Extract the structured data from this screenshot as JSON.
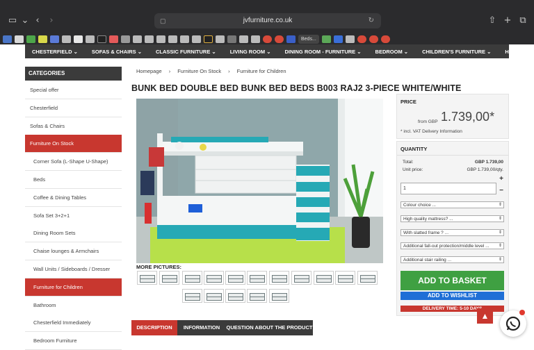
{
  "browser": {
    "url": "jvfurniture.co.uk",
    "active_tab_label": "Beds...",
    "icons": [
      "sidebar-icon",
      "chevron-down-icon",
      "back-icon",
      "forward-icon",
      "tabs-icon",
      "reload-icon",
      "share-icon",
      "new-tab-icon",
      "tab-overview-icon"
    ]
  },
  "site_nav": {
    "items": [
      "CHESTERFIELD ⌄",
      "SOFAS & CHAIRS ⌄",
      "CLASSIC FURNITURE ⌄",
      "LIVING ROOM ⌄",
      "DINING ROOM - FURNITURE ⌄",
      "BEDROOM ⌄",
      "CHILDREN'S FURNITURE ⌄",
      "HOME DECOR ⌄"
    ]
  },
  "sidebar": {
    "header": "CATEGORIES",
    "items": [
      {
        "label": "Special offer",
        "sub": false,
        "active": false
      },
      {
        "label": "Chesterfield",
        "sub": false,
        "active": false
      },
      {
        "label": "Sofas & Chairs",
        "sub": false,
        "active": false
      },
      {
        "label": "Furniture On Stock",
        "sub": false,
        "active": true
      },
      {
        "label": "Corner Sofa (L-Shape U-Shape)",
        "sub": true,
        "active": false
      },
      {
        "label": "Beds",
        "sub": true,
        "active": false
      },
      {
        "label": "Coffee & Dining Tables",
        "sub": true,
        "active": false
      },
      {
        "label": "Sofa Set 3+2+1",
        "sub": true,
        "active": false
      },
      {
        "label": "Dining Room Sets",
        "sub": true,
        "active": false
      },
      {
        "label": "Chaise lounges & Armchairs",
        "sub": true,
        "active": false
      },
      {
        "label": "Wall Units / Sideboards / Dresser",
        "sub": true,
        "active": false
      },
      {
        "label": "Furniture for Children",
        "sub": true,
        "active": true
      },
      {
        "label": "Bathroom",
        "sub": true,
        "active": false
      },
      {
        "label": "Chesterfield Immediately",
        "sub": true,
        "active": false
      },
      {
        "label": "Bedroom Furniture",
        "sub": true,
        "active": false
      }
    ]
  },
  "breadcrumb": [
    "Homepage",
    "Furniture On Stock",
    "Furniture for Children"
  ],
  "breadcrumb_sep": "›",
  "product": {
    "title": "BUNK BED DOUBLE BED BUNK BED BEDS B003 RAJ2 3-PIECE WHITE/WHITE",
    "more_pictures_label": "MORE PICTURES:"
  },
  "price": {
    "header": "PRICE",
    "from_label": "from GBP",
    "amount": "1.739,00*",
    "note": "* incl. VAT Delivery Information"
  },
  "quantity": {
    "header": "QUANTITY",
    "total_label": "Total:",
    "total_value": "GBP 1.739,00",
    "unit_label": "Unit price:",
    "unit_value": "GBP 1.739,00/qty.",
    "value": "1",
    "plus": "+",
    "minus": "−"
  },
  "options": [
    "Colour choice ...",
    "High quality mattress? ...",
    "With slatted frame ? ...",
    "Additional fall-out protection/middle level ...",
    "Additional stair railing ..."
  ],
  "actions": {
    "add_basket": "ADD TO BASKET",
    "add_wishlist": "ADD TO WISHLIST",
    "delivery": "DELIVERY TIME: 5-10 DAYS"
  },
  "tabs": [
    "DESCRIPTION",
    "INFORMATION",
    "QUESTION ABOUT THE PRODUCT"
  ],
  "colors": {
    "accent_red": "#c8372f",
    "nav_dark": "#3b3b3b",
    "basket_green": "#3fa042",
    "wishlist_blue": "#1f6fd6",
    "bed_teal": "#26a9b5"
  }
}
